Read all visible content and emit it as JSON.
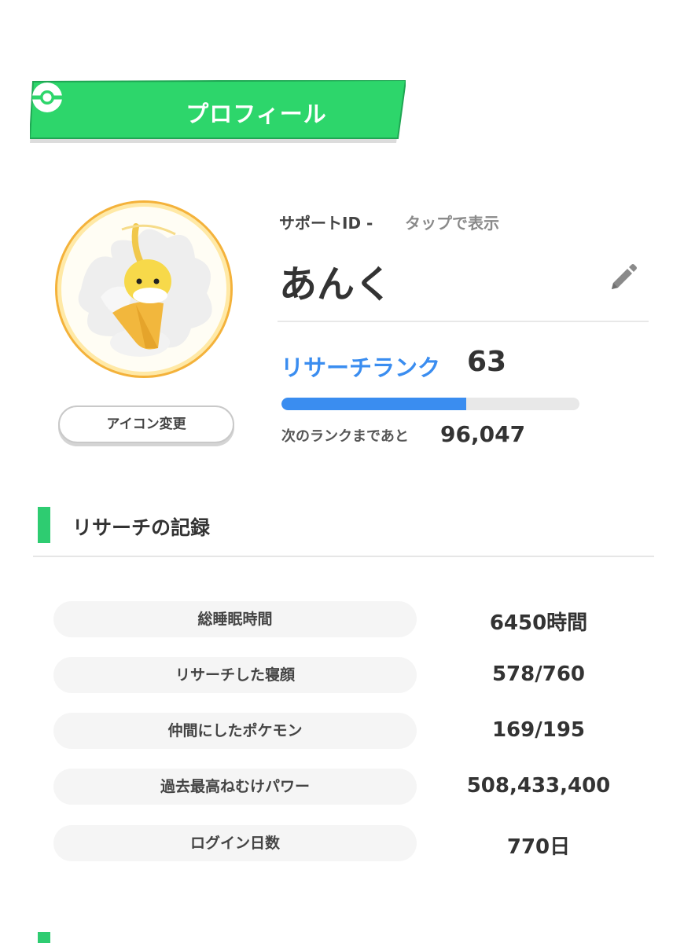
{
  "header": {
    "title": "プロフィール",
    "icon": "pokeball-icon",
    "color": "#2dd66b"
  },
  "profile": {
    "support_id_label": "サポートID -",
    "support_id_tap": "タップで表示",
    "name": "あんく",
    "icon_change_label": "アイコン変更",
    "rank_label": "リサーチランク",
    "rank_value": "63",
    "rank_progress": 0.62,
    "next_rank_label": "次のランクまであと",
    "next_rank_value": "96,047"
  },
  "records": {
    "title": "リサーチの記録",
    "rows": [
      {
        "label": "総睡眠時間",
        "value": "6450時間"
      },
      {
        "label": "リサーチした寝顔",
        "value": "578/760"
      },
      {
        "label": "仲間にしたポケモン",
        "value": "169/195"
      },
      {
        "label": "過去最高ねむけパワー",
        "value": "508,433,400"
      },
      {
        "label": "ログイン日数",
        "value": "770日"
      }
    ]
  },
  "colors": {
    "accent_green": "#2ecc71",
    "rank_blue": "#3a8df0"
  }
}
